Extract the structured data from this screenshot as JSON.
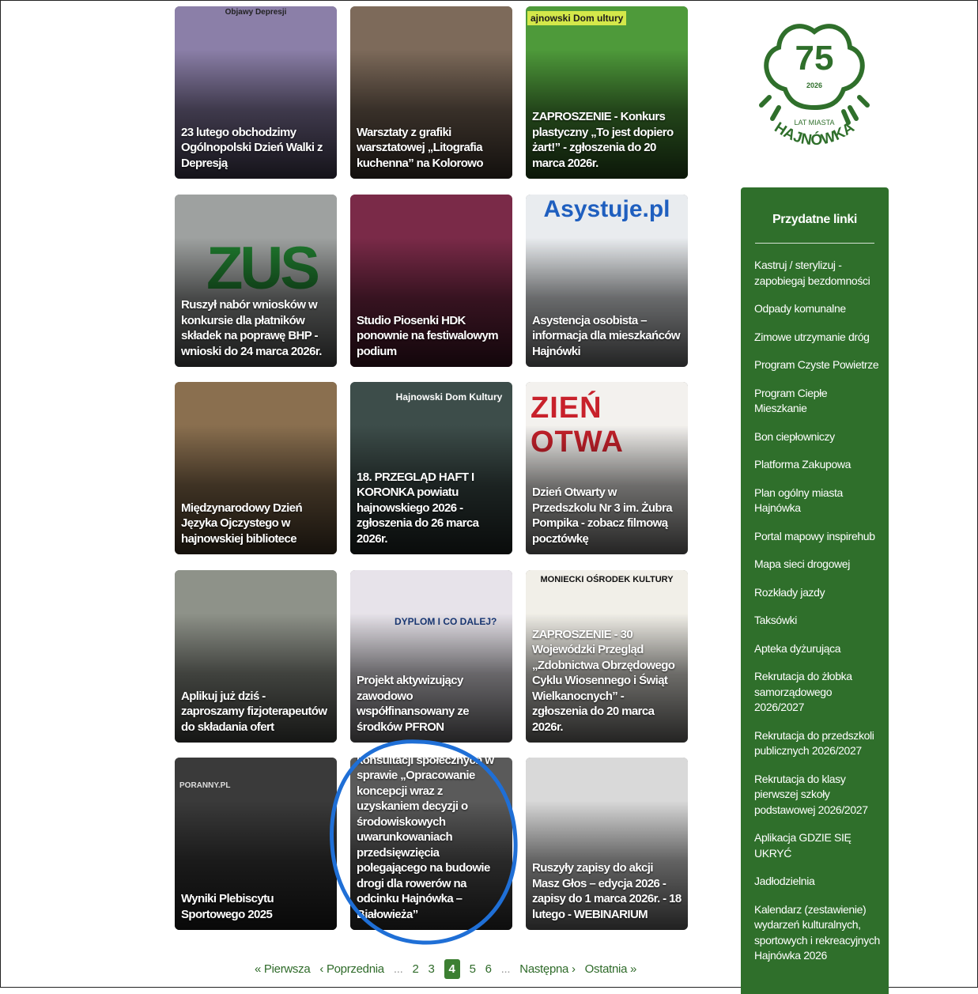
{
  "news": [
    {
      "caption": "23 lutego obchodzimy Ogólnopolski Dzień Walki z Depresją",
      "art": "Objawy Depresji",
      "bg": "#8b7fa8"
    },
    {
      "caption": "Warsztaty z grafiki warsztatowej „Litografia kuchenna” na Kolorowo",
      "art": "",
      "bg": "#7d6a5a"
    },
    {
      "caption": "ZAPROSZENIE - Konkurs plastyczny „To jest dopiero żart!” - zgłoszenia do 20 marca 2026r.",
      "art": "ajnowski Dom ultury",
      "bg": "#4e9a3a"
    },
    {
      "caption": "Ruszył nabór wniosków w konkursie dla płatników składek na poprawę BHP - wnioski do 24 marca 2026r.",
      "art": "ZUS",
      "bg": "#9ea1a0"
    },
    {
      "caption": "Studio Piosenki HDK ponownie na festiwalowym podium",
      "art": "",
      "bg": "#7a2a48"
    },
    {
      "caption": "Asystencja osobista – informacja dla mieszkańców Hajnówki",
      "art": "Asystuje.pl",
      "bg": "#e9ecef"
    },
    {
      "caption": "Międzynarodowy Dzień Języka Ojczystego w hajnowskiej bibliotece",
      "art": "",
      "bg": "#8a6f4f"
    },
    {
      "caption": "18. PRZEGLĄD HAFT I KORONKA powiatu hajnowskiego 2026 - zgłoszenia do 26 marca 2026r.",
      "art": "Hajnowski Dom Kultury",
      "bg": "#3d4d4a"
    },
    {
      "caption": "Dzień Otwarty w Przedszkolu Nr 3 im. Żubra Pompika - zobacz filmową pocztówkę",
      "art": "ZIEŃ OTWA",
      "bg": "#f3f1ee"
    },
    {
      "caption": "Aplikuj już dziś - zaproszamy fizjoterapeutów do składania ofert",
      "art": "",
      "bg": "#8e9289"
    },
    {
      "caption": "Projekt aktywizujący zawodowo współfinansowany ze środków PFRON",
      "art": "DYPLOM I CO DALEJ?",
      "bg": "#e7e3ea"
    },
    {
      "caption": "ZAPROSZENIE - 30 Wojewódzki Przegląd „Zdobnictwa Obrzędowego Cyklu Wiosennego i Świąt Wielkanocnych” - zgłoszenia do 20 marca 2026r.",
      "art": "MONIECKI OŚRODEK KULTURY",
      "bg": "#f1efe8"
    },
    {
      "caption": "Wyniki Plebiscytu Sportowego 2025",
      "art": "PORANNY.PL",
      "bg": "#3a3a3a"
    },
    {
      "caption": "ZAPROSZENIE do konsultacji społecznych w sprawie „Opracowanie koncepcji wraz z uzyskaniem decyzji o środowiskowych uwarunkowaniach przedsięwzięcia polegającego na budowie drogi dla rowerów na odcinku Hajnówka – Białowieża”",
      "art": "",
      "bg": "#5a5a5a"
    },
    {
      "caption": "Ruszyły zapisy do akcji Masz Głos – edycja 2026 - zapisy do 1 marca 2026r. - 18 lutego - WEBINARIUM",
      "art": "",
      "bg": "#d9d9d9"
    }
  ],
  "pagination": {
    "first": "« Pierwsza",
    "prev": "‹ Poprzednia",
    "dots": "...",
    "pages": [
      "2",
      "3",
      "4",
      "5",
      "6"
    ],
    "current": "4",
    "next": "Następna ›",
    "last": "Ostatnia »"
  },
  "logo": {
    "number": "75",
    "year": "2026",
    "tagline": "LAT MIASTA",
    "city": "HAJNÓWKA",
    "color": "#2f6f2b"
  },
  "sidebar": {
    "title": "Przydatne linki",
    "links": [
      "Kastruj / sterylizuj - zapobiegaj bezdomności",
      "Odpady komunalne",
      "Zimowe utrzymanie dróg",
      "Program Czyste Powietrze",
      "Program Ciepłe Mieszkanie",
      "Bon ciepłowniczy",
      "Platforma Zakupowa",
      "Plan ogólny miasta Hajnówka",
      "Portal mapowy inspirehub",
      "Mapa sieci drogowej",
      "Rozkłady jazdy",
      "Taksówki",
      "Apteka dyżurująca",
      "Rekrutacja do żłobka samorządowego 2026/2027",
      "Rekrutacja do przedszkoli publicznych 2026/2027",
      "Rekrutacja do klasy pierwszej szkoły podstawowej 2026/2027",
      "Aplikacja GDZIE SIĘ UKRYĆ",
      "Jadłodzielnia",
      "Kalendarz (zestawienie) wydarzeń kulturalnych, sportowych i rekreacyjnych Hajnówka 2026"
    ]
  }
}
